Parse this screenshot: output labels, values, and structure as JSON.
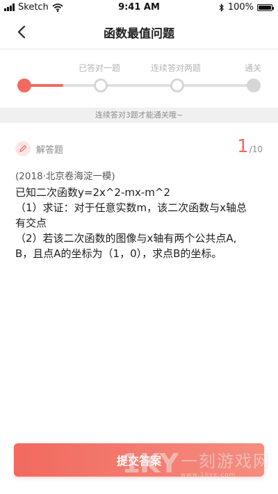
{
  "status_bar": {
    "carrier": "Sketch",
    "time": "9:41 AM",
    "battery": "100%",
    "battery_level": 1.0
  },
  "nav": {
    "title": "函数最值问题"
  },
  "progress": {
    "milestones": [
      "已答对一题",
      "连续答对两题",
      "通关"
    ],
    "hint": "连续答对3题才能通关哦~",
    "fill_fraction": 0.17
  },
  "question": {
    "type_label": "解答题",
    "current_index": "1",
    "total": "/10",
    "source": "(2018·北京卷海淀一模)",
    "lines": [
      "已知二次函数y=2x^2-mx-m^2",
      "（1）求证：对于任意实数m，该二次函数与x轴总",
      "有交点",
      "（2）若该二次函数的图像与x轴有两个公共点A,",
      "B，且点A的坐标为（1，0），求点B的坐标。"
    ]
  },
  "footer": {
    "submit_label": "提交答案"
  },
  "watermark": {
    "logo": "1KY",
    "name": "一刻游戏网",
    "url": "www.1kyx.com"
  },
  "colors": {
    "accent": "#f2695f",
    "track": "#e0e0e0"
  }
}
